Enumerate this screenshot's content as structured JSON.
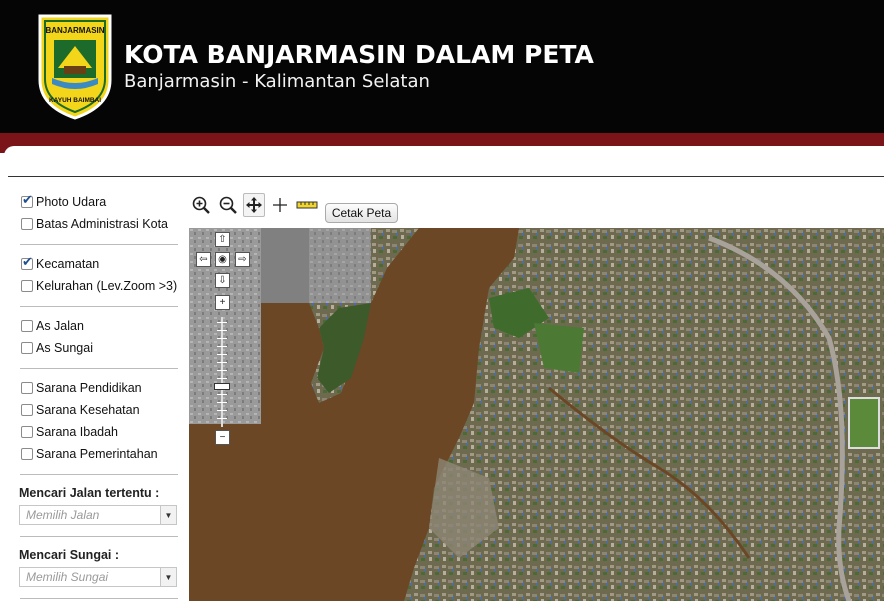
{
  "header": {
    "logo_top_text": "BANJARMASIN",
    "logo_bottom_text": "KAYUH BAIMBAI",
    "title": "KOTA BANJARMASIN DALAM PETA",
    "subtitle": "Banjarmasin - Kalimantan Selatan"
  },
  "layers": {
    "group1": [
      {
        "label": "Photo Udara",
        "checked": true
      },
      {
        "label": "Batas Administrasi Kota",
        "checked": false
      }
    ],
    "group2": [
      {
        "label": "Kecamatan",
        "checked": true
      },
      {
        "label": "Kelurahan (Lev.Zoom >3)",
        "checked": false
      }
    ],
    "group3": [
      {
        "label": "As Jalan",
        "checked": false
      },
      {
        "label": "As Sungai",
        "checked": false
      }
    ],
    "group4": [
      {
        "label": "Sarana Pendidikan",
        "checked": false
      },
      {
        "label": "Sarana Kesehatan",
        "checked": false
      },
      {
        "label": "Sarana Ibadah",
        "checked": false
      },
      {
        "label": "Sarana Pemerintahan",
        "checked": false
      }
    ]
  },
  "search": {
    "road_label": "Mencari Jalan tertentu :",
    "road_placeholder": "Memilih Jalan",
    "river_label": "Mencari Sungai :",
    "river_placeholder": "Memilih Sungai"
  },
  "toolbar": {
    "tools": [
      "zoom-in-icon",
      "zoom-out-icon",
      "pan-icon",
      "crosshair-icon",
      "measure-icon"
    ],
    "print_label": "Cetak Peta"
  },
  "map": {
    "zoom_level": 7,
    "zoom_levels": 14
  },
  "colors": {
    "header_bg": "#050505",
    "accent_band": "#7a1418",
    "river": "#6b4726",
    "checkbox_check": "#1f4f8f"
  }
}
